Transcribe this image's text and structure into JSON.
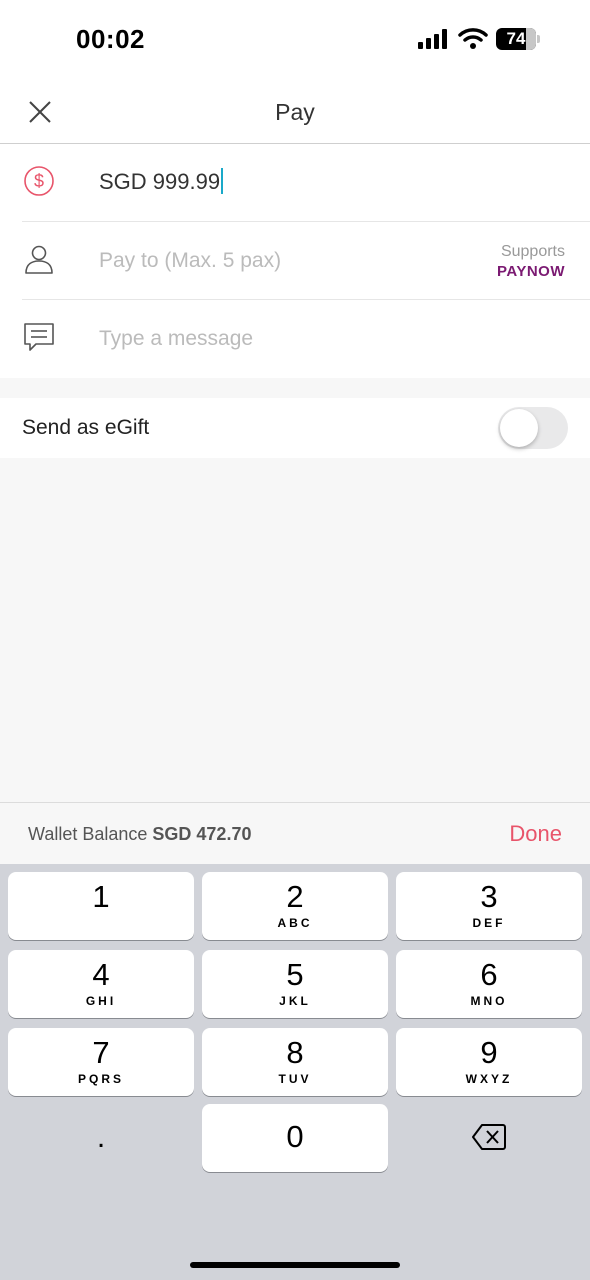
{
  "status_bar": {
    "time": "00:02",
    "battery": "74",
    "battery_level": 0.74
  },
  "header": {
    "title": "Pay"
  },
  "form": {
    "amount_value": "SGD 999.99",
    "pay_to_placeholder": "Pay to (Max. 5 pax)",
    "supports_label": "Supports",
    "paynow_label": "PAYNOW",
    "message_placeholder": "Type a message"
  },
  "egift": {
    "label": "Send as eGift",
    "enabled": false
  },
  "wallet": {
    "label": "Wallet Balance",
    "amount": "SGD 472.70",
    "done_label": "Done"
  },
  "keypad": {
    "keys": [
      {
        "num": "1",
        "letters": ""
      },
      {
        "num": "2",
        "letters": "ABC"
      },
      {
        "num": "3",
        "letters": "DEF"
      },
      {
        "num": "4",
        "letters": "GHI"
      },
      {
        "num": "5",
        "letters": "JKL"
      },
      {
        "num": "6",
        "letters": "MNO"
      },
      {
        "num": "7",
        "letters": "PQRS"
      },
      {
        "num": "8",
        "letters": "TUV"
      },
      {
        "num": "9",
        "letters": "WXYZ"
      },
      {
        "num": "0",
        "letters": ""
      }
    ],
    "decimal": "."
  },
  "colors": {
    "accent": "#e8546a",
    "paynow": "#7b1a72",
    "caret": "#1aa9c9"
  }
}
